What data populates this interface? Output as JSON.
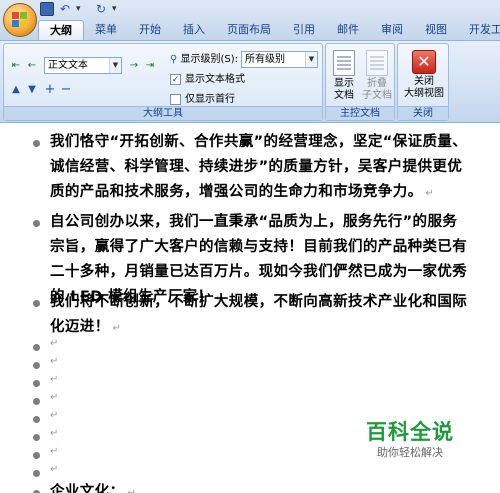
{
  "quick_access": {
    "save_icon": "save-icon",
    "undo_icon": "undo-icon",
    "redo_icon": "redo-icon",
    "more_icon": "dropdown-icon"
  },
  "tabs": [
    "大纲",
    "菜单",
    "开始",
    "插入",
    "页面布局",
    "引用",
    "邮件",
    "审阅",
    "视图",
    "开发工具"
  ],
  "outline_group": {
    "label": "大纲工具",
    "level_select": "正文文本",
    "show_level_label": "显示级别(S):",
    "show_level_value": "所有级别",
    "show_text_format_label": "显示文本格式",
    "show_text_format_checked": true,
    "first_line_only_label": "仅显示首行",
    "first_line_only_checked": false
  },
  "master_group": {
    "label": "主控文档",
    "show_doc_line1": "显示",
    "show_doc_line2": "文档",
    "collapse_line1": "折叠",
    "collapse_line2": "子文档"
  },
  "close_group": {
    "label": "关闭",
    "close_line1": "关闭",
    "close_line2": "大纲视图"
  },
  "document": {
    "para1": "我们恪守“开拓创新、合作共赢”的经营理念，坚定“保证质量、诚信经营、科学管理、持续进步”的质量方针，吴客户提供更优质的产品和技术服务，增强公司的生命力和市场竞争力。",
    "para2": "自公司创办以来，我们一直秉承“品质为上，服务先行”的服务宗旨，赢得了广大客户的信赖与支持！目前我们的产品种类已有二十多种，月销量已达百万片。现如今我们俨然已成为一家优秀的 LED 模组生产厂家！",
    "para3": "我们将不断创新，不断扩大规模，不断向高新技术产业化和国际化迈进！",
    "para4": "企业文化：",
    "paragraph_mark": "↵"
  },
  "watermark": {
    "title": "百科全说",
    "subtitle": "助你轻松解决"
  },
  "colors": {
    "ribbon_blue": "#c4d6ec",
    "tab_text": "#15428b",
    "watermark_green": "#1e9b3c"
  }
}
